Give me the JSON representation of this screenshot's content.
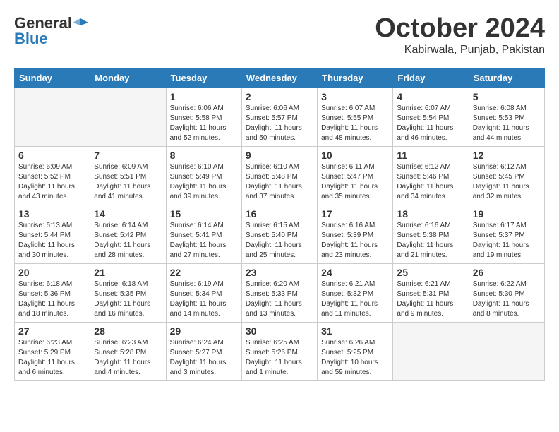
{
  "header": {
    "logo_general": "General",
    "logo_blue": "Blue",
    "month_title": "October 2024",
    "location": "Kabirwala, Punjab, Pakistan"
  },
  "days_of_week": [
    "Sunday",
    "Monday",
    "Tuesday",
    "Wednesday",
    "Thursday",
    "Friday",
    "Saturday"
  ],
  "weeks": [
    [
      {
        "day": "",
        "info": ""
      },
      {
        "day": "",
        "info": ""
      },
      {
        "day": "1",
        "info": "Sunrise: 6:06 AM\nSunset: 5:58 PM\nDaylight: 11 hours and 52 minutes."
      },
      {
        "day": "2",
        "info": "Sunrise: 6:06 AM\nSunset: 5:57 PM\nDaylight: 11 hours and 50 minutes."
      },
      {
        "day": "3",
        "info": "Sunrise: 6:07 AM\nSunset: 5:55 PM\nDaylight: 11 hours and 48 minutes."
      },
      {
        "day": "4",
        "info": "Sunrise: 6:07 AM\nSunset: 5:54 PM\nDaylight: 11 hours and 46 minutes."
      },
      {
        "day": "5",
        "info": "Sunrise: 6:08 AM\nSunset: 5:53 PM\nDaylight: 11 hours and 44 minutes."
      }
    ],
    [
      {
        "day": "6",
        "info": "Sunrise: 6:09 AM\nSunset: 5:52 PM\nDaylight: 11 hours and 43 minutes."
      },
      {
        "day": "7",
        "info": "Sunrise: 6:09 AM\nSunset: 5:51 PM\nDaylight: 11 hours and 41 minutes."
      },
      {
        "day": "8",
        "info": "Sunrise: 6:10 AM\nSunset: 5:49 PM\nDaylight: 11 hours and 39 minutes."
      },
      {
        "day": "9",
        "info": "Sunrise: 6:10 AM\nSunset: 5:48 PM\nDaylight: 11 hours and 37 minutes."
      },
      {
        "day": "10",
        "info": "Sunrise: 6:11 AM\nSunset: 5:47 PM\nDaylight: 11 hours and 35 minutes."
      },
      {
        "day": "11",
        "info": "Sunrise: 6:12 AM\nSunset: 5:46 PM\nDaylight: 11 hours and 34 minutes."
      },
      {
        "day": "12",
        "info": "Sunrise: 6:12 AM\nSunset: 5:45 PM\nDaylight: 11 hours and 32 minutes."
      }
    ],
    [
      {
        "day": "13",
        "info": "Sunrise: 6:13 AM\nSunset: 5:44 PM\nDaylight: 11 hours and 30 minutes."
      },
      {
        "day": "14",
        "info": "Sunrise: 6:14 AM\nSunset: 5:42 PM\nDaylight: 11 hours and 28 minutes."
      },
      {
        "day": "15",
        "info": "Sunrise: 6:14 AM\nSunset: 5:41 PM\nDaylight: 11 hours and 27 minutes."
      },
      {
        "day": "16",
        "info": "Sunrise: 6:15 AM\nSunset: 5:40 PM\nDaylight: 11 hours and 25 minutes."
      },
      {
        "day": "17",
        "info": "Sunrise: 6:16 AM\nSunset: 5:39 PM\nDaylight: 11 hours and 23 minutes."
      },
      {
        "day": "18",
        "info": "Sunrise: 6:16 AM\nSunset: 5:38 PM\nDaylight: 11 hours and 21 minutes."
      },
      {
        "day": "19",
        "info": "Sunrise: 6:17 AM\nSunset: 5:37 PM\nDaylight: 11 hours and 19 minutes."
      }
    ],
    [
      {
        "day": "20",
        "info": "Sunrise: 6:18 AM\nSunset: 5:36 PM\nDaylight: 11 hours and 18 minutes."
      },
      {
        "day": "21",
        "info": "Sunrise: 6:18 AM\nSunset: 5:35 PM\nDaylight: 11 hours and 16 minutes."
      },
      {
        "day": "22",
        "info": "Sunrise: 6:19 AM\nSunset: 5:34 PM\nDaylight: 11 hours and 14 minutes."
      },
      {
        "day": "23",
        "info": "Sunrise: 6:20 AM\nSunset: 5:33 PM\nDaylight: 11 hours and 13 minutes."
      },
      {
        "day": "24",
        "info": "Sunrise: 6:21 AM\nSunset: 5:32 PM\nDaylight: 11 hours and 11 minutes."
      },
      {
        "day": "25",
        "info": "Sunrise: 6:21 AM\nSunset: 5:31 PM\nDaylight: 11 hours and 9 minutes."
      },
      {
        "day": "26",
        "info": "Sunrise: 6:22 AM\nSunset: 5:30 PM\nDaylight: 11 hours and 8 minutes."
      }
    ],
    [
      {
        "day": "27",
        "info": "Sunrise: 6:23 AM\nSunset: 5:29 PM\nDaylight: 11 hours and 6 minutes."
      },
      {
        "day": "28",
        "info": "Sunrise: 6:23 AM\nSunset: 5:28 PM\nDaylight: 11 hours and 4 minutes."
      },
      {
        "day": "29",
        "info": "Sunrise: 6:24 AM\nSunset: 5:27 PM\nDaylight: 11 hours and 3 minutes."
      },
      {
        "day": "30",
        "info": "Sunrise: 6:25 AM\nSunset: 5:26 PM\nDaylight: 11 hours and 1 minute."
      },
      {
        "day": "31",
        "info": "Sunrise: 6:26 AM\nSunset: 5:25 PM\nDaylight: 10 hours and 59 minutes."
      },
      {
        "day": "",
        "info": ""
      },
      {
        "day": "",
        "info": ""
      }
    ]
  ]
}
